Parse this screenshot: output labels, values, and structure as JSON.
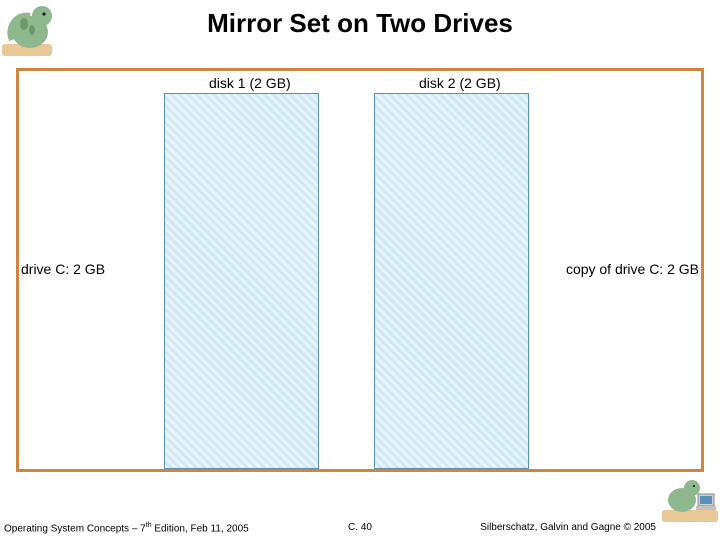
{
  "title": "Mirror Set on Two Drives",
  "diagram": {
    "disk1_label": "disk 1 (2 GB)",
    "disk2_label": "disk 2 (2 GB)",
    "left_label": "drive C: 2 GB",
    "right_label": "copy of drive C: 2 GB"
  },
  "footer": {
    "left_pre": "Operating System Concepts – 7",
    "left_sup": "th",
    "left_post": " Edition, Feb 11, 2005",
    "center": "C. 40",
    "right": "Silberschatz, Galvin and Gagne © 2005"
  },
  "icons": {
    "dino": "dinosaur-mascot-icon"
  }
}
